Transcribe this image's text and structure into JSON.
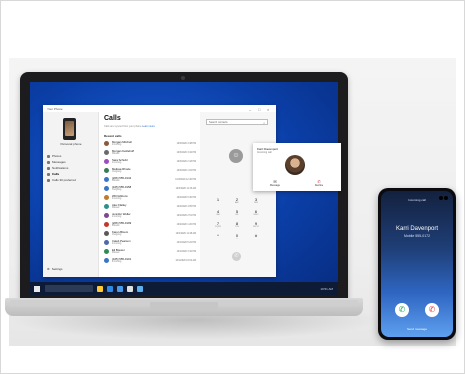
{
  "app": {
    "window_title": "Your Phone",
    "sidebar": {
      "phone_label": "Personal phone",
      "items": [
        {
          "label": "Photos",
          "active": false
        },
        {
          "label": "Messages",
          "active": false
        },
        {
          "label": "Notifications",
          "active": false
        },
        {
          "label": "Calls",
          "active": true
        },
        {
          "label": "Calls 30 preferred",
          "active": false
        }
      ],
      "settings_label": "Settings"
    },
    "calls": {
      "title": "Calls",
      "subtitle": "Calls are synced from your phone",
      "subtitle_link": "Learn more",
      "section_label": "Recent calls",
      "rows": [
        {
          "name": "Morgan Mitchell",
          "type": "Incoming",
          "time": "10/3/2020 3:48 PM",
          "color": "#8a5a3c"
        },
        {
          "name": "Morgan Kettlehoff",
          "type": "Missed",
          "time": "10/3/2020 3:42 PM",
          "color": "#6a6a6a"
        },
        {
          "name": "Sara Schultz",
          "type": "Incoming",
          "time": "10/3/2020 2:18 PM",
          "color": "#9b4ec2"
        },
        {
          "name": "Melissa Rhode",
          "type": "Outgoing",
          "time": "10/3/2020 1:02 PM",
          "color": "#3b7a57"
        },
        {
          "name": "(206) 555-0142",
          "type": "Missed",
          "time": "10/3/2020 12:40 PM",
          "color": "#3a75c4"
        },
        {
          "name": "(425) 555-0158",
          "type": "Outgoing",
          "time": "10/3/2020 11:15 AM",
          "color": "#3a75c4"
        },
        {
          "name": "Will Gibbons",
          "type": "Incoming",
          "time": "10/2/2020 6:30 PM",
          "color": "#c07a2c"
        },
        {
          "name": "Alex Flatley",
          "type": "Missed",
          "time": "10/2/2020 4:05 PM",
          "color": "#2f8f8f"
        },
        {
          "name": "Jennifer Weller",
          "type": "Incoming",
          "time": "10/2/2020 2:51 PM",
          "color": "#7a4a8c"
        },
        {
          "name": "(206) 555-0199",
          "type": "Missed",
          "time": "10/2/2020 1:20 PM",
          "color": "#c0392b"
        },
        {
          "name": "Karen Bloom",
          "type": "Outgoing",
          "time": "10/2/2020 11:48 AM",
          "color": "#5a5a5a"
        },
        {
          "name": "Caleb Pearson",
          "type": "Incoming",
          "time": "10/1/2020 5:22 PM",
          "color": "#4a6aa8"
        },
        {
          "name": "Eli Brewer",
          "type": "Missed",
          "time": "10/1/2020 3:10 PM",
          "color": "#2e8b57"
        },
        {
          "name": "(425) 555-0101",
          "type": "Incoming",
          "time": "10/1/2020 10:04 AM",
          "color": "#3a75c4"
        }
      ]
    },
    "dialer": {
      "search_placeholder": "Search contacts",
      "keys": [
        {
          "n": "1",
          "l": ""
        },
        {
          "n": "2",
          "l": "ABC"
        },
        {
          "n": "3",
          "l": "DEF"
        },
        {
          "n": "4",
          "l": "GHI"
        },
        {
          "n": "5",
          "l": "JKL"
        },
        {
          "n": "6",
          "l": "MNO"
        },
        {
          "n": "7",
          "l": "PQRS"
        },
        {
          "n": "8",
          "l": "TUV"
        },
        {
          "n": "9",
          "l": "WXYZ"
        },
        {
          "n": "*",
          "l": ""
        },
        {
          "n": "0",
          "l": "+"
        },
        {
          "n": "#",
          "l": ""
        }
      ]
    }
  },
  "toast": {
    "caller": "Karri Davenport",
    "subtitle": "Incoming call",
    "actions": [
      {
        "label": "Message",
        "icon": "message-icon"
      },
      {
        "label": "Decline",
        "icon": "decline-icon"
      }
    ],
    "accept_label": "Accept"
  },
  "taskbar": {
    "clock": "10:51 AM"
  },
  "phone": {
    "status": "Incoming call",
    "caller": "Karri Davenport",
    "number": "Mobile 555-0172",
    "message_label": "Send message"
  },
  "colors": {
    "desktop": "#0b3fa8",
    "accent": "#1a6fd6",
    "accept": "#1aa84a",
    "decline": "#e03a3a"
  }
}
